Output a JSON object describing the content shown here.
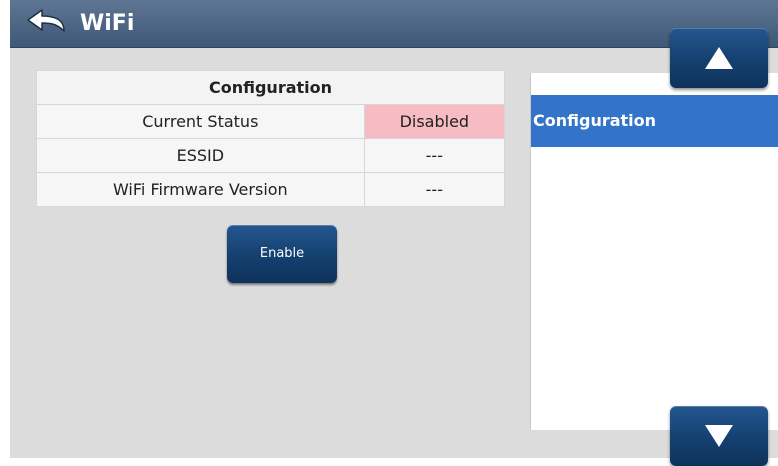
{
  "header": {
    "title": "WiFi",
    "back_icon": "back-arrow-icon"
  },
  "configuration": {
    "heading": "Configuration",
    "rows": [
      {
        "label": "Current Status",
        "value": "Disabled",
        "status_color": "#f7bcc3"
      },
      {
        "label": "ESSID",
        "value": "---"
      },
      {
        "label": "WiFi Firmware Version",
        "value": "---"
      }
    ]
  },
  "actions": {
    "enable_label": "Enable"
  },
  "side_menu": {
    "items": [
      {
        "label": "Configuration",
        "selected": true
      }
    ]
  },
  "scroll": {
    "up_icon": "arrow-up-icon",
    "down_icon": "arrow-down-icon"
  },
  "colors": {
    "header": "#4a6382",
    "button": "#14406f",
    "selected_item": "#3374c9",
    "background": "#dcdcdc"
  }
}
